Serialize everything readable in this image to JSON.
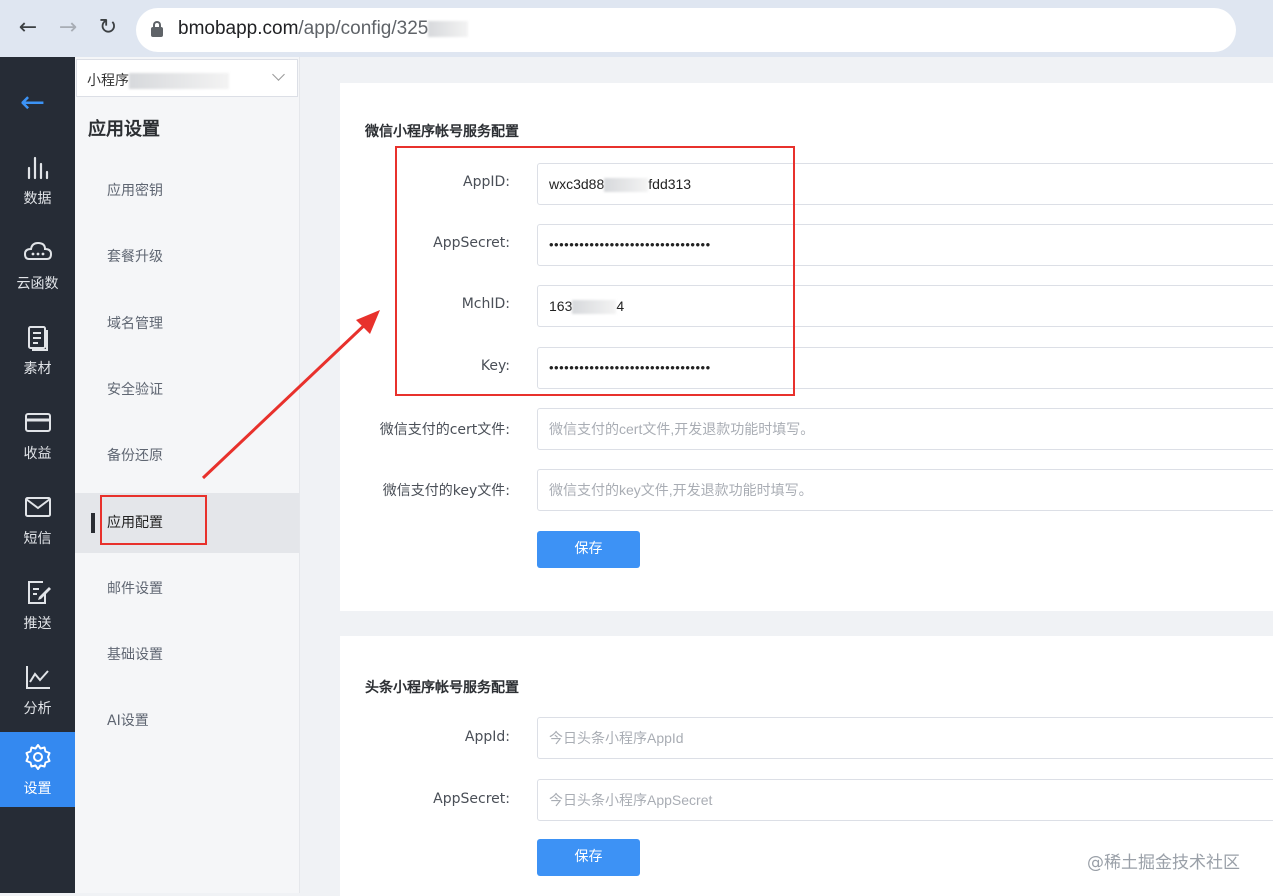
{
  "browser": {
    "url_host": "bmobapp.com",
    "url_path": "/app/config/325"
  },
  "dark_sidebar": {
    "items": [
      {
        "label": "数据",
        "icon": "bar-chart-icon"
      },
      {
        "label": "云函数",
        "icon": "cloud-icon"
      },
      {
        "label": "素材",
        "icon": "document-icon"
      },
      {
        "label": "收益",
        "icon": "card-icon"
      },
      {
        "label": "短信",
        "icon": "mail-icon"
      },
      {
        "label": "推送",
        "icon": "edit-icon"
      },
      {
        "label": "分析",
        "icon": "line-chart-icon"
      },
      {
        "label": "设置",
        "icon": "gear-icon",
        "active": true
      }
    ]
  },
  "secondary_sidebar": {
    "app_select": "小程序",
    "title": "应用设置",
    "items": [
      {
        "label": "应用密钥"
      },
      {
        "label": "套餐升级"
      },
      {
        "label": "域名管理"
      },
      {
        "label": "安全验证"
      },
      {
        "label": "备份还原"
      },
      {
        "label": "应用配置",
        "active": true
      },
      {
        "label": "邮件设置"
      },
      {
        "label": "基础设置"
      },
      {
        "label": "AI设置"
      }
    ]
  },
  "wechat_section": {
    "title": "微信小程序帐号服务配置",
    "fields": [
      {
        "label": "AppID:",
        "value": "wxc3d88",
        "value_tail": "fdd313"
      },
      {
        "label": "AppSecret:",
        "value": "••••••••••••••••••••••••••••••••"
      },
      {
        "label": "MchID:",
        "value": "163",
        "value_tail": "4"
      },
      {
        "label": "Key:",
        "value": "••••••••••••••••••••••••••••••••"
      },
      {
        "label": "微信支付的cert文件:",
        "placeholder": "微信支付的cert文件,开发退款功能时填写。"
      },
      {
        "label": "微信支付的key文件:",
        "placeholder": "微信支付的key文件,开发退款功能时填写。"
      }
    ],
    "save_label": "保存"
  },
  "toutiao_section": {
    "title": "头条小程序帐号服务配置",
    "fields": [
      {
        "label": "AppId:",
        "placeholder": "今日头条小程序AppId"
      },
      {
        "label": "AppSecret:",
        "placeholder": "今日头条小程序AppSecret"
      }
    ],
    "save_label": "保存"
  },
  "watermark": "@稀土掘金技术社区",
  "colors": {
    "accent": "#3d92f5",
    "dark_sidebar": "#262c36",
    "annotation_red": "#e8312c"
  }
}
